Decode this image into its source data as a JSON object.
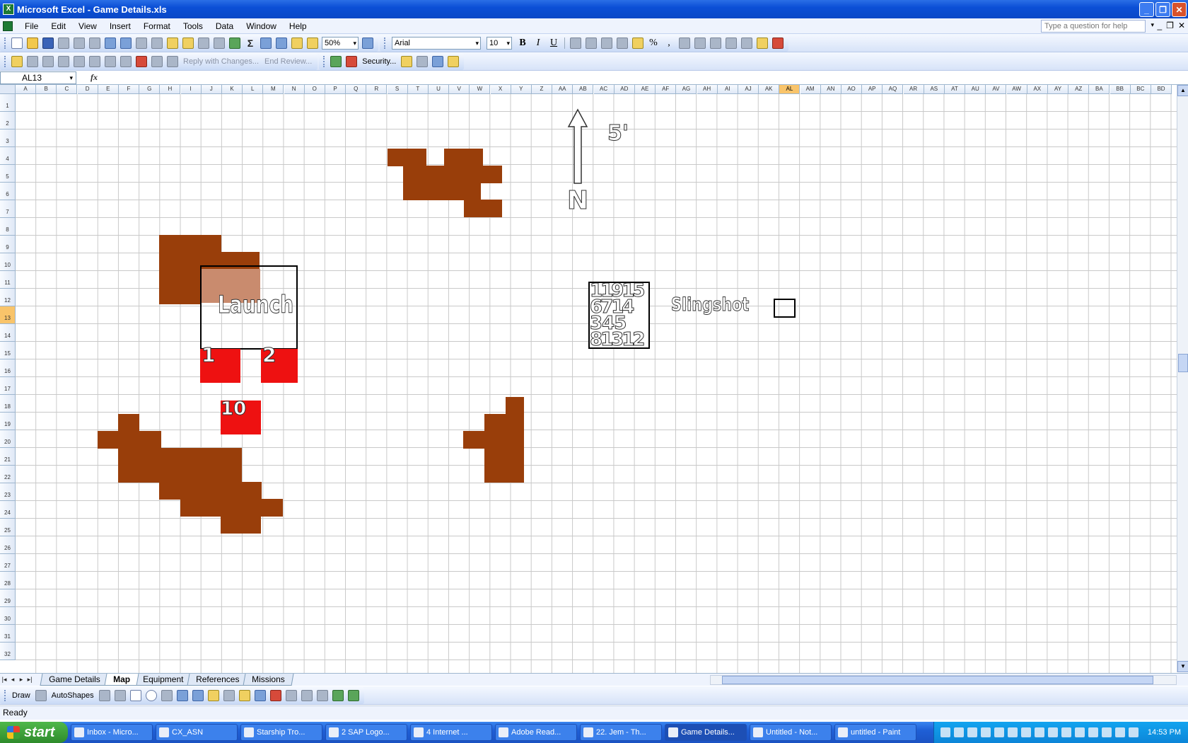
{
  "window": {
    "title": "Microsoft Excel - Game Details.xls"
  },
  "menu": {
    "items": [
      "File",
      "Edit",
      "View",
      "Insert",
      "Format",
      "Tools",
      "Data",
      "Window",
      "Help"
    ],
    "help_placeholder": "Type a question for help"
  },
  "toolbar": {
    "zoom": "50%",
    "font": "Arial",
    "font_size": "10",
    "bold": "B",
    "italic": "I",
    "underline": "U",
    "percent": "%",
    "comma": ",",
    "reply_with_changes": "Reply with Changes...",
    "end_review": "End Review...",
    "security": "Security..."
  },
  "formula_bar": {
    "name_box": "AL13",
    "fx": "fx",
    "value": ""
  },
  "grid": {
    "columns": [
      "A",
      "B",
      "C",
      "D",
      "E",
      "F",
      "G",
      "H",
      "I",
      "J",
      "K",
      "L",
      "M",
      "N",
      "O",
      "P",
      "Q",
      "R",
      "S",
      "T",
      "U",
      "V",
      "W",
      "X",
      "Y",
      "Z",
      "AA",
      "AB",
      "AC",
      "AD",
      "AE",
      "AF",
      "AG",
      "AH",
      "AI",
      "AJ",
      "AK",
      "AL",
      "AM",
      "AN",
      "AO",
      "AP",
      "AQ",
      "AR",
      "AS",
      "AT",
      "AU",
      "AV",
      "AW",
      "AX",
      "AY",
      "AZ",
      "BA",
      "BB",
      "BC",
      "BD"
    ],
    "rows": [
      "1",
      "2",
      "3",
      "4",
      "5",
      "6",
      "7",
      "8",
      "9",
      "10",
      "11",
      "12",
      "13",
      "14",
      "15",
      "16",
      "17",
      "18",
      "19",
      "20",
      "21",
      "22",
      "23",
      "24",
      "25",
      "26",
      "27",
      "28",
      "29",
      "30",
      "31",
      "32"
    ],
    "selected_column": "AL",
    "selected_row": "13"
  },
  "map": {
    "launch_label": "Launch",
    "pad_labels": [
      "1",
      "2",
      "10"
    ],
    "scale_label": "5'",
    "north_label": "N",
    "slingshot_label": "Slingshot",
    "number_grid": [
      [
        "1",
        "1",
        "9",
        "1",
        "5"
      ],
      [
        "6",
        "7",
        "1",
        "4"
      ],
      [
        "3",
        "4",
        "5"
      ],
      [
        "8",
        "1",
        "3",
        "1",
        "2"
      ]
    ]
  },
  "sheet_tabs": [
    "Game Details",
    "Map",
    "Equipment",
    "References",
    "Missions"
  ],
  "active_sheet": "Map",
  "draw_toolbar": {
    "draw": "Draw",
    "autoshapes": "AutoShapes"
  },
  "status": {
    "text": "Ready"
  },
  "taskbar": {
    "start": "start",
    "tasks": [
      "Inbox - Micro...",
      "CX_ASN",
      "Starship Tro...",
      "2 SAP Logo...",
      "4 Internet ...",
      "Adobe Read...",
      "22. Jem - Th...",
      "Game Details...",
      "Untitled - Not...",
      "untitled - Paint"
    ],
    "active_task": "Game Details...",
    "clock": "14:53 PM"
  },
  "colors": {
    "rock": "#993e0a",
    "pad": "#ee1111",
    "title_blue": "#0b4fd6",
    "selection_header": "#f9c46a"
  }
}
